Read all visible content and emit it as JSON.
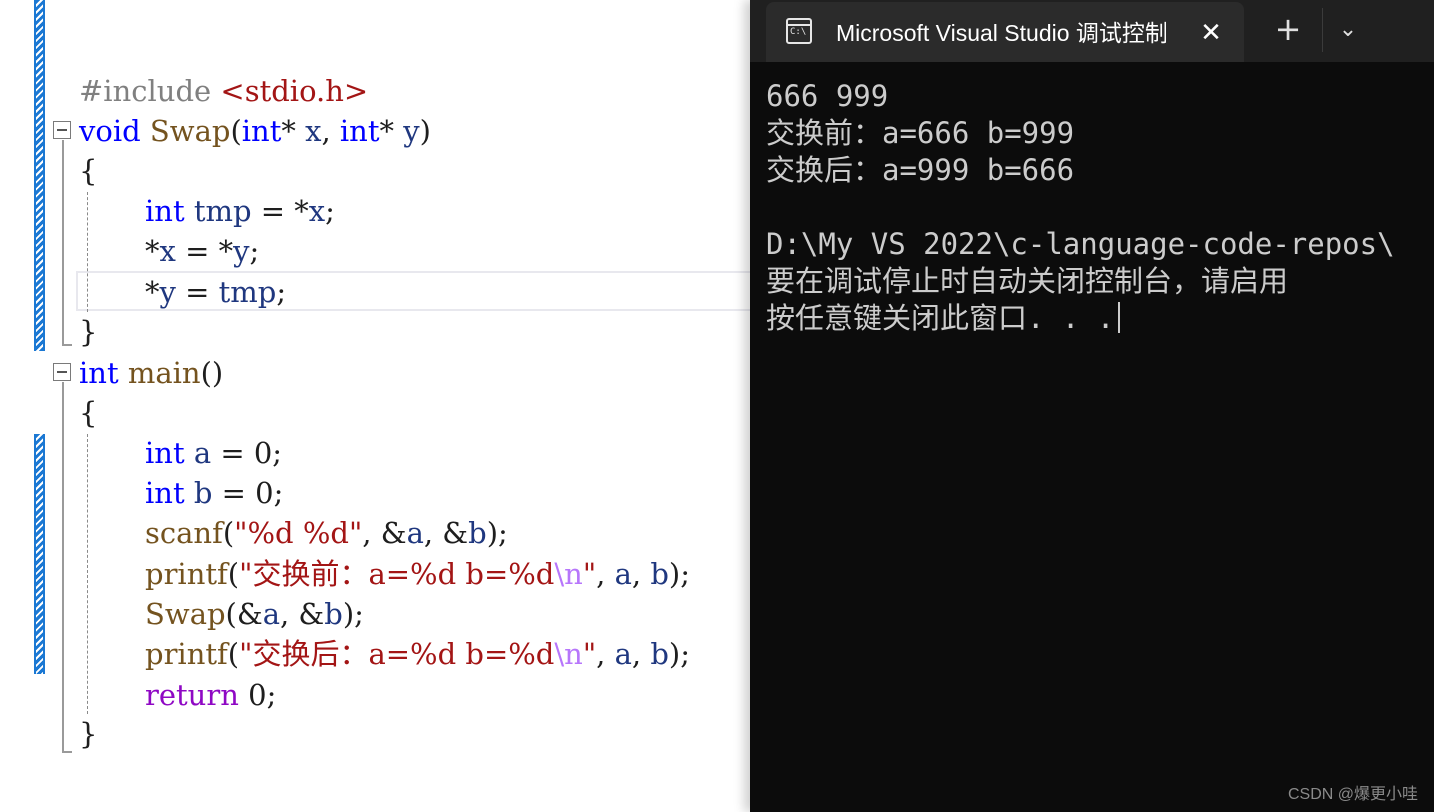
{
  "editor": {
    "lines": [
      [
        {
          "t": "#include ",
          "c": "pp"
        },
        {
          "t": "<stdio.h>",
          "c": "str"
        }
      ],
      [
        {
          "t": "void",
          "c": "kw"
        },
        {
          "t": " "
        },
        {
          "t": "Swap",
          "c": "fn"
        },
        {
          "t": "("
        },
        {
          "t": "int",
          "c": "kw"
        },
        {
          "t": "* "
        },
        {
          "t": "x",
          "c": "var"
        },
        {
          "t": ", "
        },
        {
          "t": "int",
          "c": "kw"
        },
        {
          "t": "* "
        },
        {
          "t": "y",
          "c": "var"
        },
        {
          "t": ")"
        }
      ],
      [
        {
          "t": "{"
        }
      ],
      [
        {
          "t": "int",
          "c": "kw"
        },
        {
          "t": " "
        },
        {
          "t": "tmp",
          "c": "var"
        },
        {
          "t": " = *"
        },
        {
          "t": "x",
          "c": "var"
        },
        {
          "t": ";"
        }
      ],
      [
        {
          "t": "*"
        },
        {
          "t": "x",
          "c": "var"
        },
        {
          "t": " = *"
        },
        {
          "t": "y",
          "c": "var"
        },
        {
          "t": ";"
        }
      ],
      [
        {
          "t": "*"
        },
        {
          "t": "y",
          "c": "var"
        },
        {
          "t": " = "
        },
        {
          "t": "tmp",
          "c": "var"
        },
        {
          "t": ";"
        }
      ],
      [
        {
          "t": "}"
        }
      ],
      [
        {
          "t": "int",
          "c": "kw"
        },
        {
          "t": " "
        },
        {
          "t": "main",
          "c": "fn"
        },
        {
          "t": "()"
        }
      ],
      [
        {
          "t": "{"
        }
      ],
      [
        {
          "t": "int",
          "c": "kw"
        },
        {
          "t": " "
        },
        {
          "t": "a",
          "c": "var"
        },
        {
          "t": " = 0;"
        }
      ],
      [
        {
          "t": "int",
          "c": "kw"
        },
        {
          "t": " "
        },
        {
          "t": "b",
          "c": "var"
        },
        {
          "t": " = 0;"
        }
      ],
      [
        {
          "t": "scanf",
          "c": "fn"
        },
        {
          "t": "("
        },
        {
          "t": "\"%d %d\"",
          "c": "str"
        },
        {
          "t": ", &"
        },
        {
          "t": "a",
          "c": "var"
        },
        {
          "t": ", &"
        },
        {
          "t": "b",
          "c": "var"
        },
        {
          "t": ");"
        }
      ],
      [
        {
          "t": "printf",
          "c": "fn"
        },
        {
          "t": "("
        },
        {
          "t": "\"交换前：a=%d b=%d",
          "c": "str"
        },
        {
          "t": "\\n",
          "c": "esc"
        },
        {
          "t": "\"",
          "c": "str"
        },
        {
          "t": ", "
        },
        {
          "t": "a",
          "c": "var"
        },
        {
          "t": ", "
        },
        {
          "t": "b",
          "c": "var"
        },
        {
          "t": ");"
        }
      ],
      [
        {
          "t": "Swap",
          "c": "fn"
        },
        {
          "t": "(&"
        },
        {
          "t": "a",
          "c": "var"
        },
        {
          "t": ", &"
        },
        {
          "t": "b",
          "c": "var"
        },
        {
          "t": ");"
        }
      ],
      [
        {
          "t": "printf",
          "c": "fn"
        },
        {
          "t": "("
        },
        {
          "t": "\"交换后：a=%d b=%d",
          "c": "str"
        },
        {
          "t": "\\n",
          "c": "esc"
        },
        {
          "t": "\"",
          "c": "str"
        },
        {
          "t": ", "
        },
        {
          "t": "a",
          "c": "var"
        },
        {
          "t": ", "
        },
        {
          "t": "b",
          "c": "var"
        },
        {
          "t": ");"
        }
      ],
      [
        {
          "t": "return",
          "c": "ctl"
        },
        {
          "t": " 0;"
        }
      ],
      [
        {
          "t": "}"
        }
      ]
    ]
  },
  "terminal": {
    "tab_title": "Microsoft Visual Studio 调试控制台",
    "tab_icon_text": "C:\\",
    "close_icon": "✕",
    "new_tab_icon": "+",
    "dropdown_icon": "⌄",
    "output": [
      "666 999",
      "交换前：a=666 b=999",
      "交换后：a=999 b=666",
      "",
      "D:\\My VS 2022\\c-language-code-repos\\",
      "要在调试停止时自动关闭控制台，请启用",
      "按任意键关闭此窗口. . ."
    ]
  },
  "watermark": "CSDN @爆更小哇"
}
